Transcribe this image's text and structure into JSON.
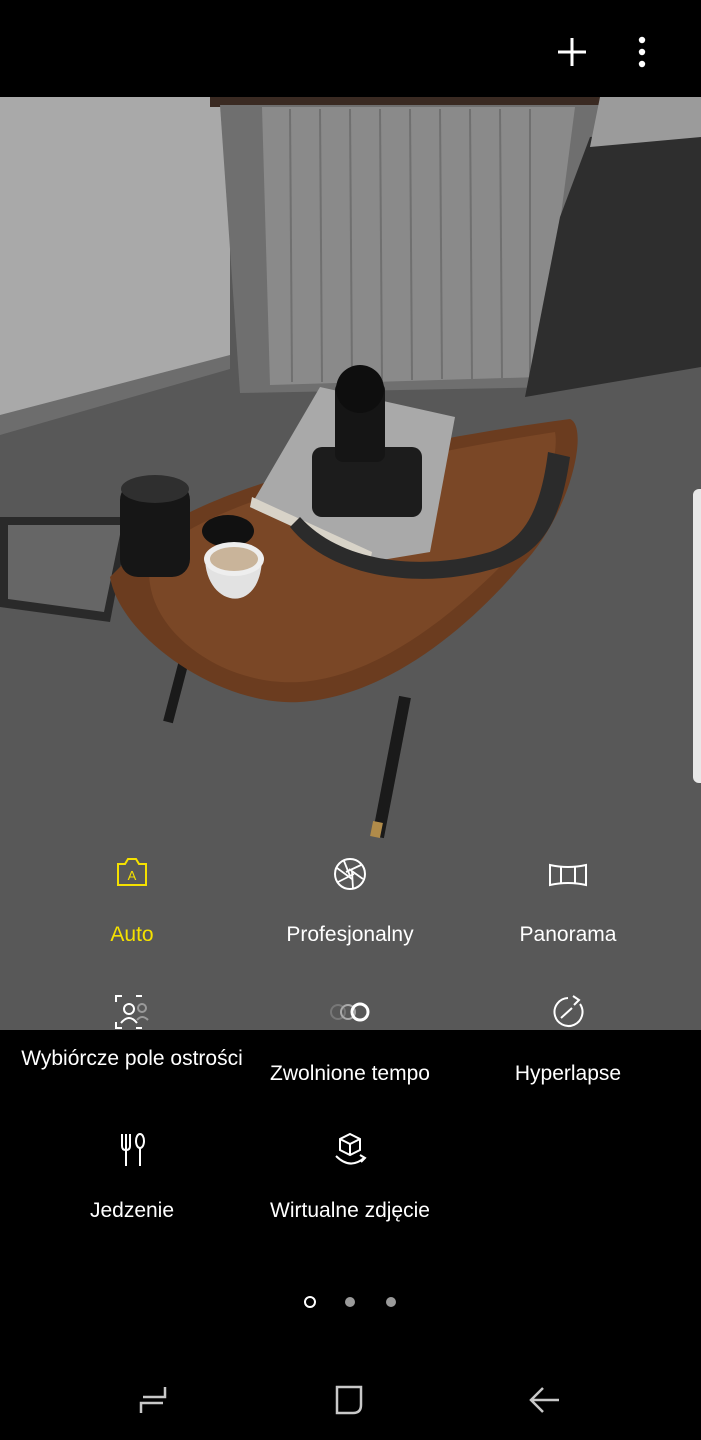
{
  "modes": [
    {
      "id": "auto",
      "label": "Auto",
      "icon": "auto-camera-icon",
      "active": true
    },
    {
      "id": "pro",
      "label": "Profesjonalny",
      "icon": "aperture-icon",
      "active": false
    },
    {
      "id": "panorama",
      "label": "Panorama",
      "icon": "panorama-icon",
      "active": false
    },
    {
      "id": "selective",
      "label": "Wybiórcze pole ostrości",
      "icon": "selective-focus-icon",
      "active": false
    },
    {
      "id": "slowmo",
      "label": "Zwolnione tempo",
      "icon": "slow-motion-icon",
      "active": false
    },
    {
      "id": "hyperlapse",
      "label": "Hyperlapse",
      "icon": "hyperlapse-icon",
      "active": false
    },
    {
      "id": "food",
      "label": "Jedzenie",
      "icon": "food-icon",
      "active": false
    },
    {
      "id": "virtual",
      "label": "Wirtualne zdjęcie",
      "icon": "virtual-shot-icon",
      "active": false
    }
  ],
  "pager": {
    "current_page": 1,
    "total_pages": 3
  },
  "colors": {
    "active": "#f5e100",
    "text": "#ffffff",
    "background": "#000000"
  }
}
